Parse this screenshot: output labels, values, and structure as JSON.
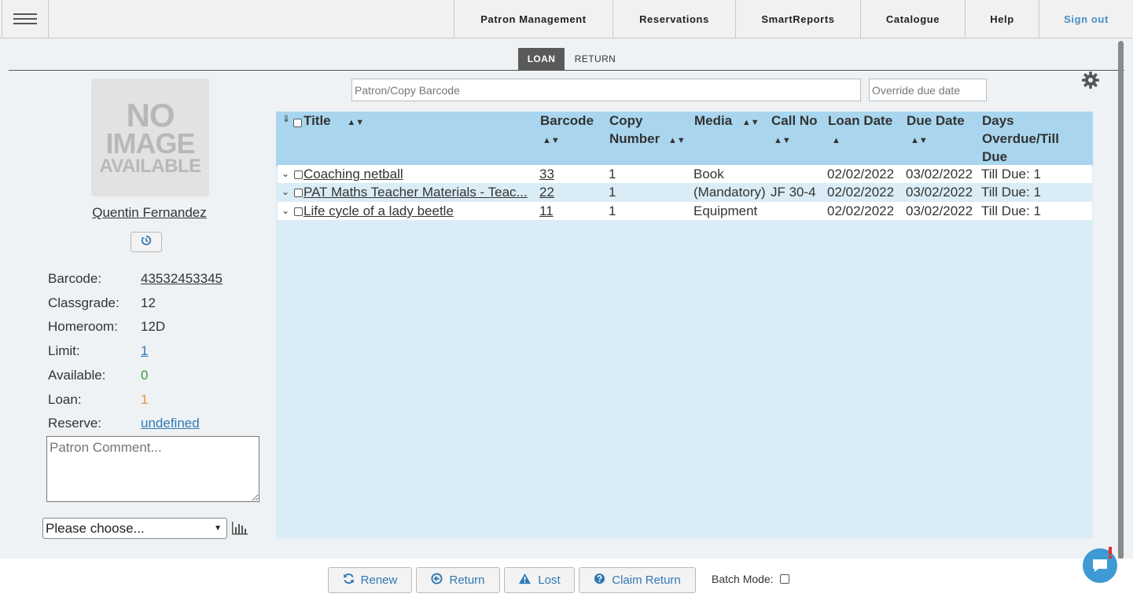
{
  "nav": {
    "items": [
      {
        "label": "Patron Management"
      },
      {
        "label": "Reservations"
      },
      {
        "label": "SmartReports"
      },
      {
        "label": "Catalogue"
      },
      {
        "label": "Help"
      },
      {
        "label": "Sign out"
      }
    ]
  },
  "tabs": {
    "loan": "LOAN",
    "return": "RETURN",
    "active": "LOAN"
  },
  "scan": {
    "barcode_placeholder": "Patron/Copy Barcode",
    "due_date_placeholder": "Override due date"
  },
  "patron": {
    "image_text": [
      "NO",
      "IMAGE",
      "AVAILABLE"
    ],
    "name": "Quentin Fernandez",
    "fields": {
      "barcode_label": "Barcode:",
      "barcode_value": "43532453345",
      "classgrade_label": "Classgrade:",
      "classgrade_value": "12",
      "homeroom_label": "Homeroom:",
      "homeroom_value": "12D",
      "limit_label": "Limit:",
      "limit_value": "1",
      "available_label": "Available:",
      "available_value": "0",
      "loan_label": "Loan:",
      "loan_value": "1",
      "reserve_label": "Reserve:",
      "reserve_value": "undefined"
    },
    "comment_placeholder": "Patron Comment...",
    "choose_value": "Please choose..."
  },
  "table": {
    "headers": {
      "title": "Title",
      "barcode": "Barcode",
      "copy_number_1": "Copy",
      "copy_number_2": "Number",
      "media": "Media",
      "call_no": "Call No",
      "loan_date": "Loan Date",
      "due_date": "Due Date",
      "days_1": "Days",
      "days_2": "Overdue/Till",
      "days_3": "Due"
    },
    "rows": [
      {
        "title": "Coaching netball",
        "barcode": "33",
        "copy": "1",
        "media": "Book",
        "call_no": "",
        "loan_date": "02/02/2022",
        "due_date": "03/02/2022",
        "days": "Till Due: 1"
      },
      {
        "title": "PAT Maths Teacher Materials - Teac...",
        "barcode": "22",
        "copy": "1",
        "media": "(Mandatory)",
        "call_no": "JF 30-4",
        "loan_date": "02/02/2022",
        "due_date": "03/02/2022",
        "days": "Till Due: 1"
      },
      {
        "title": "Life cycle of a lady beetle",
        "barcode": "11",
        "copy": "1",
        "media": "Equipment",
        "call_no": "",
        "loan_date": "02/02/2022",
        "due_date": "03/02/2022",
        "days": "Till Due: 1"
      }
    ]
  },
  "actions": {
    "renew": "Renew",
    "return": "Return",
    "lost": "Lost",
    "claim_return": "Claim Return",
    "batch_mode": "Batch Mode:"
  },
  "colors": {
    "accent": "#2f78b5",
    "available": "#3a9a3a",
    "loan": "#e8933a",
    "link_blue": "#2f78b5"
  }
}
